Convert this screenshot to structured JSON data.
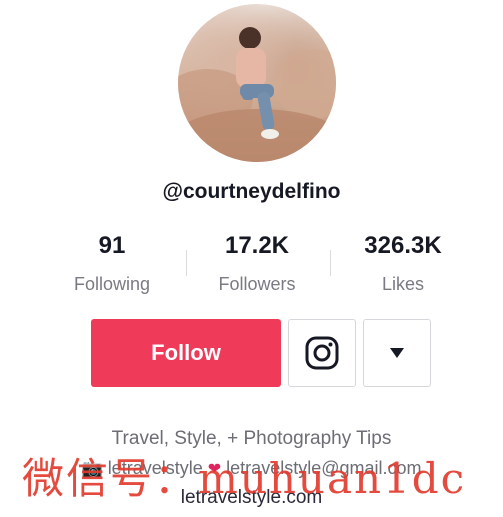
{
  "profile": {
    "username": "@courtneydelfino",
    "stats": [
      {
        "value": "91",
        "label": "Following"
      },
      {
        "value": "17.2K",
        "label": "Followers"
      },
      {
        "value": "326.3K",
        "label": "Likes"
      }
    ],
    "follow_label": "Follow",
    "bio": "Travel, Style, + Photography Tips",
    "instagram_handle": "letravelstyle",
    "email": "letravelstyle@gmail.com",
    "website": "letravelstyle.com"
  },
  "overlay": {
    "watermark": "微信号：muhuan1dc"
  },
  "colors": {
    "follow_button": "#ef3a5a",
    "text_primary": "#161823",
    "text_secondary": "#7a7b82"
  },
  "icons": [
    "instagram-icon",
    "dropdown-arrow-icon",
    "camera-emoji-icon",
    "heart-emoji-icon"
  ]
}
